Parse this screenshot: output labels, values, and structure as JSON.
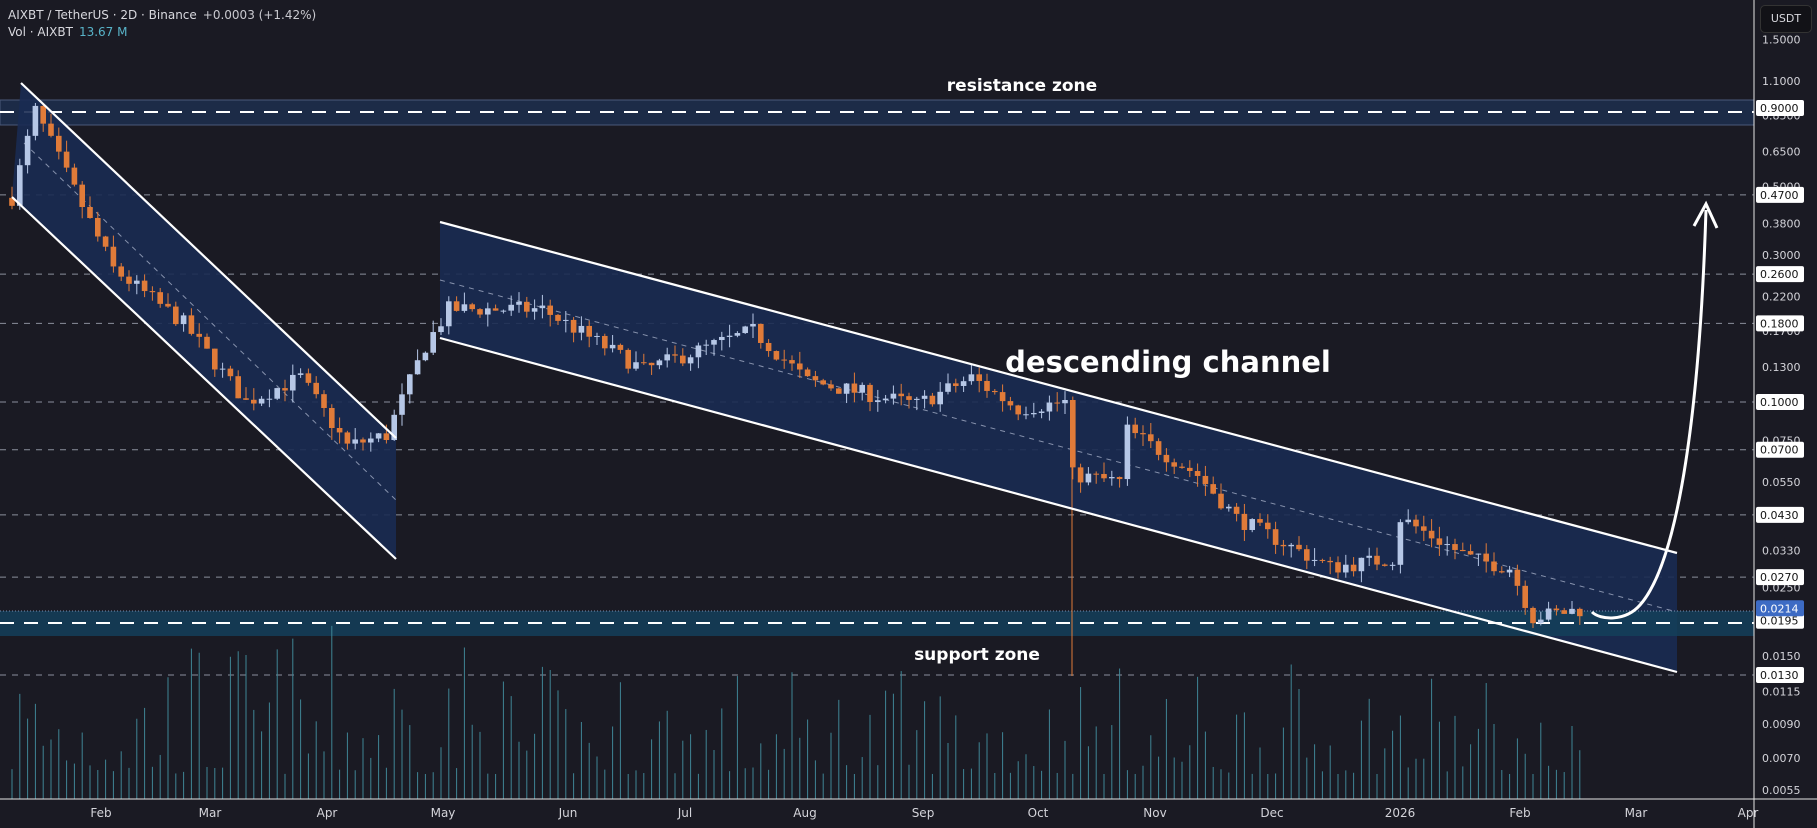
{
  "header": {
    "symbol_line": "AIXBT / TetherUS · 2D · Binance",
    "change": "+0.0003 (+1.42%)",
    "volume_label": "Vol · AIXBT",
    "volume_value": "13.67 M"
  },
  "currency_button": "USDT",
  "annotations": {
    "resistance": "resistance zone",
    "channel": "descending channel",
    "support": "support zone"
  },
  "colors": {
    "up": "#b6c7e6",
    "down": "#e07b39",
    "volume": "#3f8595",
    "channel_fill": "#1a2b52",
    "support_fill": "#14405a",
    "current_price": "#3d6bc4"
  },
  "chart_data": {
    "type": "candlestick",
    "title": "AIXBT / TetherUS · 2D · Binance",
    "y_scale": "log",
    "ylim": [
      0.0052,
      1.6
    ],
    "x_ticks": [
      "Feb",
      "Mar",
      "Apr",
      "May",
      "Jun",
      "Jul",
      "Aug",
      "Sep",
      "Oct",
      "Nov",
      "Dec",
      "2026",
      "Feb",
      "Mar",
      "Apr"
    ],
    "y_ticks": [
      "1.5000",
      "1.1000",
      "0.8500",
      "0.6500",
      "0.5000",
      "0.3800",
      "0.3000",
      "0.2200",
      "0.1700",
      "0.1300",
      "0.0750",
      "0.0550",
      "0.0330",
      "0.0250",
      "0.0150",
      "0.0115",
      "0.0090",
      "0.0070",
      "0.0055"
    ],
    "level_labels": [
      "0.9000",
      "0.4700",
      "0.2600",
      "0.1800",
      "0.1000",
      "0.0700",
      "0.0430",
      "0.0270",
      "0.0195",
      "0.0130"
    ],
    "current_price": "0.0214",
    "resistance_zone": [
      0.82,
      0.98
    ],
    "support_zone": [
      0.0178,
      0.0214
    ],
    "candle_count": 202,
    "price_path": [
      [
        0,
        0.46
      ],
      [
        3,
        0.88
      ],
      [
        13,
        0.27
      ],
      [
        22,
        0.18
      ],
      [
        30,
        0.1
      ],
      [
        37,
        0.12
      ],
      [
        43,
        0.072
      ],
      [
        48,
        0.078
      ],
      [
        53,
        0.152
      ],
      [
        56,
        0.2
      ],
      [
        68,
        0.2
      ],
      [
        81,
        0.127
      ],
      [
        95,
        0.17
      ],
      [
        102,
        0.117
      ],
      [
        116,
        0.098
      ],
      [
        123,
        0.12
      ],
      [
        129,
        0.095
      ],
      [
        135,
        0.1
      ],
      [
        136,
        0.058
      ],
      [
        142,
        0.055
      ],
      [
        143,
        0.081
      ],
      [
        152,
        0.058
      ],
      [
        157,
        0.042
      ],
      [
        169,
        0.029
      ],
      [
        177,
        0.031
      ],
      [
        178,
        0.042
      ],
      [
        187,
        0.031
      ],
      [
        192,
        0.029
      ],
      [
        195,
        0.02
      ],
      [
        201,
        0.0212
      ]
    ]
  }
}
